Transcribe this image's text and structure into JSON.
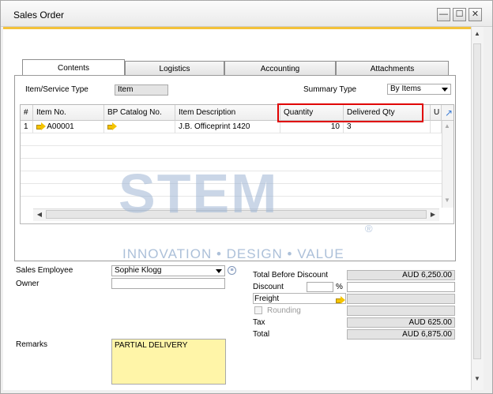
{
  "window": {
    "title": "Sales Order",
    "minimize": "—",
    "maximize": "☐",
    "close": "✕"
  },
  "tabs": [
    "Contents",
    "Logistics",
    "Accounting",
    "Attachments"
  ],
  "header": {
    "item_type_label": "Item/Service Type",
    "item_type_value": "Item",
    "summary_type_label": "Summary Type",
    "summary_type_value": "By Items"
  },
  "grid": {
    "columns": [
      "#",
      "Item No.",
      "BP Catalog No.",
      "Item Description",
      "Quantity",
      "Delivered Qty",
      "U"
    ],
    "rows": [
      {
        "num": "1",
        "item_no": "A00001",
        "bp_catalog": "",
        "description": "J.B. Officeprint 1420",
        "quantity": "10",
        "delivered": "3"
      }
    ]
  },
  "watermark": {
    "main": "STEM",
    "tagline": "INNOVATION • DESIGN • VALUE",
    "reg": "®"
  },
  "footer": {
    "sales_employee_label": "Sales Employee",
    "sales_employee_value": "Sophie Klogg",
    "owner_label": "Owner",
    "owner_value": "",
    "remarks_label": "Remarks",
    "remarks_value": "PARTIAL DELIVERY"
  },
  "totals": {
    "before_discount_label": "Total Before Discount",
    "before_discount_value": "AUD 6,250.00",
    "discount_label": "Discount",
    "discount_pct_symbol": "%",
    "freight_label": "Freight",
    "rounding_label": "Rounding",
    "tax_label": "Tax",
    "tax_value": "AUD 625.00",
    "total_label": "Total",
    "total_value": "AUD 6,875.00"
  },
  "colors": {
    "accent": "#f3c23a",
    "highlight": "#e00000",
    "remarks_bg": "#fff5a8",
    "watermark": "#9fb6d4"
  }
}
